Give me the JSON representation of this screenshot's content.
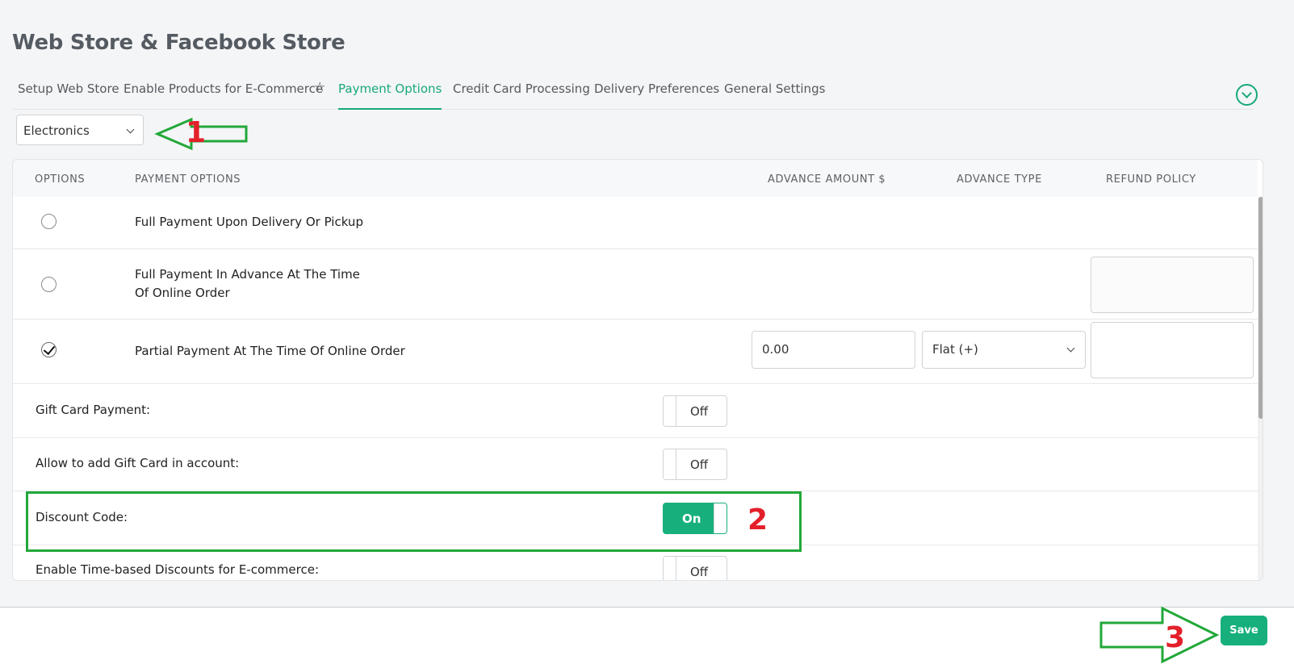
{
  "page": {
    "title": "Web Store & Facebook Store"
  },
  "tabs": [
    {
      "label": "Setup Web Store"
    },
    {
      "label": "Enable Products for E-Commerce"
    },
    {
      "label": "Payment Options",
      "active": true
    },
    {
      "label": "Credit Card Processing"
    },
    {
      "label": "Delivery Preferences"
    },
    {
      "label": "General Settings"
    }
  ],
  "store_select": {
    "value": "Electronics"
  },
  "table": {
    "headers": {
      "options": "OPTIONS",
      "payment_options": "PAYMENT OPTIONS",
      "advance_amount": "ADVANCE AMOUNT $",
      "advance_type": "ADVANCE TYPE",
      "refund_policy": "REFUND POLICY"
    },
    "rows": [
      {
        "label": "Full Payment Upon Delivery Or Pickup",
        "selected": false
      },
      {
        "label_line1": "Full Payment In Advance At The Time",
        "label_line2": "Of Online Order",
        "selected": false
      },
      {
        "label": "Partial Payment At The Time Of Online Order",
        "selected": true,
        "advance_amount": "0.00",
        "advance_type": "Flat (+)"
      }
    ]
  },
  "settings": [
    {
      "label": "Gift Card Payment:",
      "toggle": "Off"
    },
    {
      "label": "Allow to add Gift Card in account:",
      "toggle": "Off"
    },
    {
      "label": "Discount Code:",
      "toggle": "On"
    },
    {
      "label": "Enable Time-based Discounts for E-commerce:",
      "toggle": "Off"
    }
  ],
  "footer": {
    "save_label": "Save"
  },
  "annotations": {
    "n1": "1",
    "n2": "2",
    "n3": "3"
  },
  "colors": {
    "accent": "#17b07c",
    "annotation_red": "#e3202a",
    "annotation_green": "#22a83a"
  }
}
